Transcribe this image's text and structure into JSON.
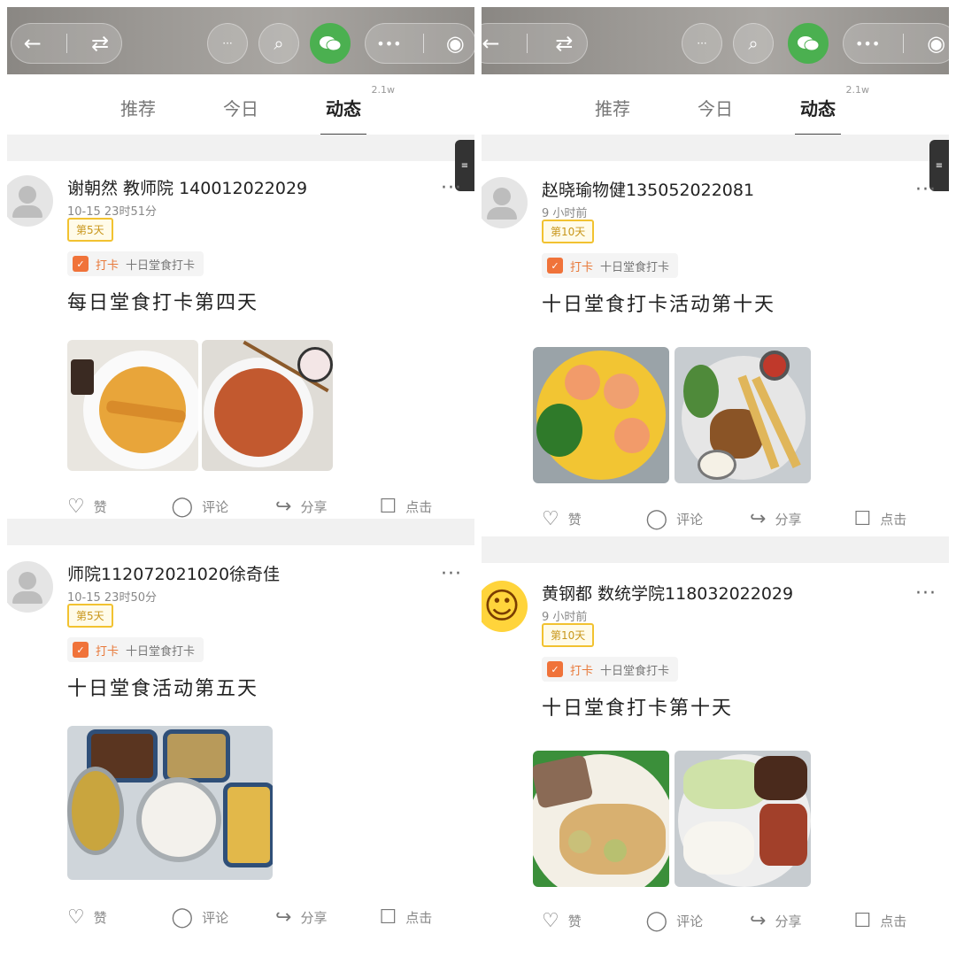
{
  "tabs": {
    "recommend": "推荐",
    "today": "今日",
    "feed": "动态",
    "feed_count": "2.1w"
  },
  "icons": {
    "back": "←",
    "switch": "⇄",
    "chat": "···",
    "search": "⌕",
    "more": "•••",
    "target": "◉",
    "wechat": "wechat-icon"
  },
  "actions": {
    "like": "赞",
    "comment": "评论",
    "share": "分享",
    "click": "点击"
  },
  "tag": {
    "kind": "打卡",
    "topic": "十日堂食打卡"
  },
  "posts": [
    {
      "author": "谢朝然 教师院 140012022029",
      "time": "10-15 23时51分",
      "badge": "第5天",
      "content": "每日堂食打卡第四天"
    },
    {
      "author": "师院112072021020徐奇佳",
      "time": "10-15 23时50分",
      "badge": "第5天",
      "content": "十日堂食活动第五天"
    },
    {
      "author": "赵晓瑜物健135052022081",
      "time": "9 小时前",
      "badge": "第10天",
      "content": "十日堂食打卡活动第十天"
    },
    {
      "author": "黄钢都 数统学院118032022029",
      "time": "9 小时前",
      "badge": "第10天",
      "content": "十日堂食打卡第十天"
    }
  ],
  "colors": {
    "badge_border": "#f2c230",
    "tag_icon": "#f0733a",
    "wechat": "#4bb050"
  }
}
